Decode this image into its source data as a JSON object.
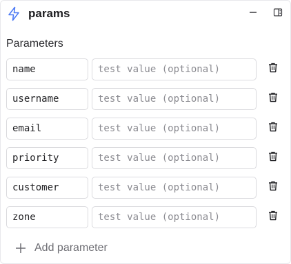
{
  "header": {
    "title": "params",
    "icons": {
      "left": "bolt-icon",
      "minimize": "minus-icon",
      "sidebar": "sidebar-panel-icon"
    }
  },
  "section": {
    "label": "Parameters"
  },
  "parameters": [
    {
      "name": "name",
      "placeholder": "test value (optional)",
      "value": ""
    },
    {
      "name": "username",
      "placeholder": "test value (optional)",
      "value": ""
    },
    {
      "name": "email",
      "placeholder": "test value (optional)",
      "value": ""
    },
    {
      "name": "priority",
      "placeholder": "test value (optional)",
      "value": ""
    },
    {
      "name": "customer",
      "placeholder": "test value (optional)",
      "value": ""
    },
    {
      "name": "zone",
      "placeholder": "test value (optional)",
      "value": ""
    }
  ],
  "add": {
    "label": "Add parameter",
    "icon": "plus-icon"
  },
  "colors": {
    "accent": "#4f7cf5",
    "border": "#dadade",
    "placeholder": "#8a8a90",
    "muted_text": "#6d6d73"
  }
}
